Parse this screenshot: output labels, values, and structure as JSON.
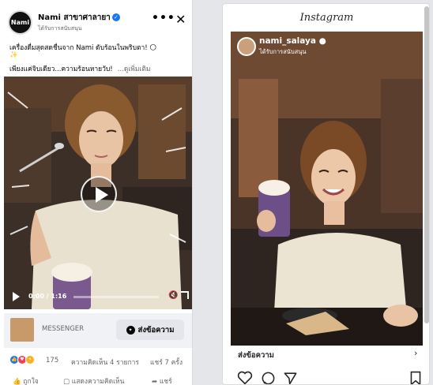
{
  "facebook": {
    "avatar_text": "Nami",
    "page_name": "Nami สาขาศาลายา",
    "sponsored": "ได้รับการสนับสนุน",
    "more_label": "•••",
    "close_label": "✕",
    "post_line1": "เครื่องดื่มสุดสดชื่นจาก Nami ดับร้อนในพริบตา! 🌕",
    "post_line2": "✨",
    "post_line3": "เพียงแค่จิบเดียว...ความร้อนหายวับ!",
    "see_more": "...ดูเพิ่มเติม",
    "video": {
      "time": "0:00 / 1:16",
      "progress": 0.0
    },
    "cta": {
      "label": "MESSENGER",
      "button": "ส่งข้อความ"
    },
    "reactions_count": "175",
    "comments": "ความคิดเห็น 4 รายการ",
    "shares": "แชร์ 7 ครั้ง",
    "actions": [
      "ถูกใจ",
      "แสดงความคิดเห็น",
      "แชร์"
    ]
  },
  "instagram": {
    "logo": "Instagram",
    "username": "nami_salaya",
    "sponsored": "ได้รับการสนับสนุน",
    "send_message": "ส่งข้อความ",
    "chevron": "›"
  },
  "colors": {
    "fb_blue": "#1877f2",
    "fb_gray": "#65676b",
    "ig_text": "#262626"
  }
}
